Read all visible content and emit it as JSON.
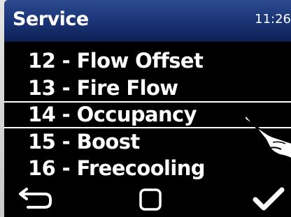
{
  "header": {
    "title": "Service",
    "time": "11:26"
  },
  "menu": {
    "items": [
      {
        "label": "12 - Flow Offset",
        "selected": false
      },
      {
        "label": "13 - Fire Flow",
        "selected": false
      },
      {
        "label": "14 - Occupancy",
        "selected": true
      },
      {
        "label": "15 - Boost",
        "selected": false
      },
      {
        "label": "16 - Freecooling",
        "selected": false
      }
    ]
  },
  "footer": {
    "icons": [
      "back-arrow-icon",
      "home-square-icon",
      "checkmark-icon"
    ]
  },
  "colors": {
    "header_top": "#2c4a8f",
    "header_bottom": "#0d2156",
    "background": "#000000",
    "text": "#ffffff"
  }
}
